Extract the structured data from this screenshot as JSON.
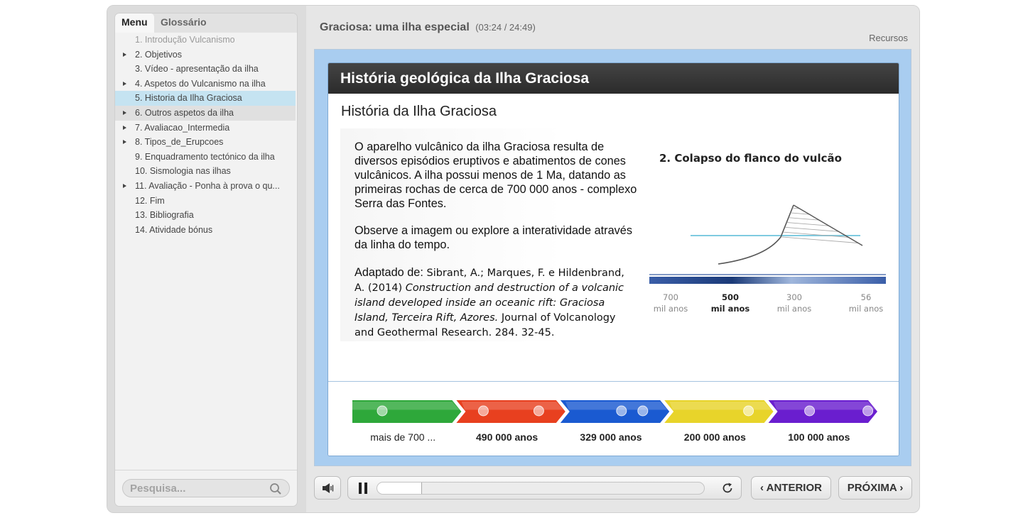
{
  "sidebar": {
    "tabs": [
      {
        "label": "Menu"
      },
      {
        "label": "Glossário"
      }
    ],
    "items": [
      {
        "label": "1. Introdução Vulcanismo",
        "caret": false,
        "state": "dim"
      },
      {
        "label": "2. Objetivos",
        "caret": true,
        "state": ""
      },
      {
        "label": "3. Vídeo - apresentação da ilha",
        "caret": false,
        "state": ""
      },
      {
        "label": "4. Aspetos do Vulcanismo na ilha",
        "caret": true,
        "state": ""
      },
      {
        "label": "5. Historia da Ilha Graciosa",
        "caret": false,
        "state": "selected"
      },
      {
        "label": "6. Outros aspetos da ilha",
        "caret": true,
        "state": "hover"
      },
      {
        "label": "7. Avaliacao_Intermedia",
        "caret": true,
        "state": ""
      },
      {
        "label": "8. Tipos_de_Erupcoes",
        "caret": true,
        "state": ""
      },
      {
        "label": "9. Enquadramento tectónico da ilha",
        "caret": false,
        "state": ""
      },
      {
        "label": "10. Sismologia nas ilhas",
        "caret": false,
        "state": ""
      },
      {
        "label": "11. Avaliação - Ponha à prova o qu...",
        "caret": true,
        "state": ""
      },
      {
        "label": "12. Fim",
        "caret": false,
        "state": ""
      },
      {
        "label": "13. Bibliografia",
        "caret": false,
        "state": ""
      },
      {
        "label": "14. Atividade bónus",
        "caret": false,
        "state": ""
      }
    ],
    "search": {
      "placeholder": "Pesquisa...",
      "icon": "search-icon"
    }
  },
  "header": {
    "title": "Graciosa: uma ilha especial",
    "time": "(03:24 / 24:49)",
    "resources": "Recursos"
  },
  "slide": {
    "header": "História geológica da Ilha Graciosa",
    "subtitle": "História da Ilha Graciosa",
    "para1": "O aparelho vulcânico da ilha Graciosa resulta de diversos episódios eruptivos e abatimentos de cones vulcânicos. A ilha possui menos de 1 Ma, datando as primeiras rochas de cerca de 700 000 anos - complexo Serra das Fontes.",
    "para2": "Observe a imagem ou explore a interatividade através da linha do tempo.",
    "para3": {
      "lead": "Adaptado de:",
      "authors": "Sibrant, A.; Marques, F. e Hildenbrand, A. (2014)",
      "title_italic": "Construction and destruction of a volcanic island developed inside an oceanic rift: Graciosa Island, Terceira Rift, Azores.",
      "journal": "Journal of Volcanology and Geothermal Research. 284. 32-45."
    },
    "diagram": {
      "title": "2. Colapso do flanco do vulcão",
      "timeline_labels": [
        {
          "value": "700",
          "unit": "mil anos",
          "active": false
        },
        {
          "value": "500",
          "unit": "mil anos",
          "active": true
        },
        {
          "value": "300",
          "unit": "mil anos",
          "active": false
        },
        {
          "value": "56",
          "unit": "mil anos",
          "active": false
        }
      ]
    },
    "timeline": {
      "eras": [
        {
          "label": "mais de 700 ...",
          "color": "#2ea83a",
          "bold": false,
          "dots": 1
        },
        {
          "label": "490 000 anos",
          "color": "#e8401f",
          "bold": true,
          "dots": 2
        },
        {
          "label": "329 000 anos",
          "color": "#1a5ad1",
          "bold": true,
          "dots": 2
        },
        {
          "label": "200 000 anos",
          "color": "#e8d42a",
          "bold": true,
          "dots": 1
        },
        {
          "label": "100 000 anos",
          "color": "#6a1ecf",
          "bold": true,
          "dots": 2
        }
      ]
    }
  },
  "controls": {
    "volume_icon": "speaker-icon",
    "pause_icon": "pause-icon",
    "progress": 0.137,
    "replay_icon": "replay-icon",
    "prev_label": "ANTERIOR",
    "next_label": "PRÓXIMA"
  },
  "colors": {
    "accent_selected": "#c5e3f1",
    "stage_bg": "#a9cdf0",
    "header_dark": "#333333"
  }
}
